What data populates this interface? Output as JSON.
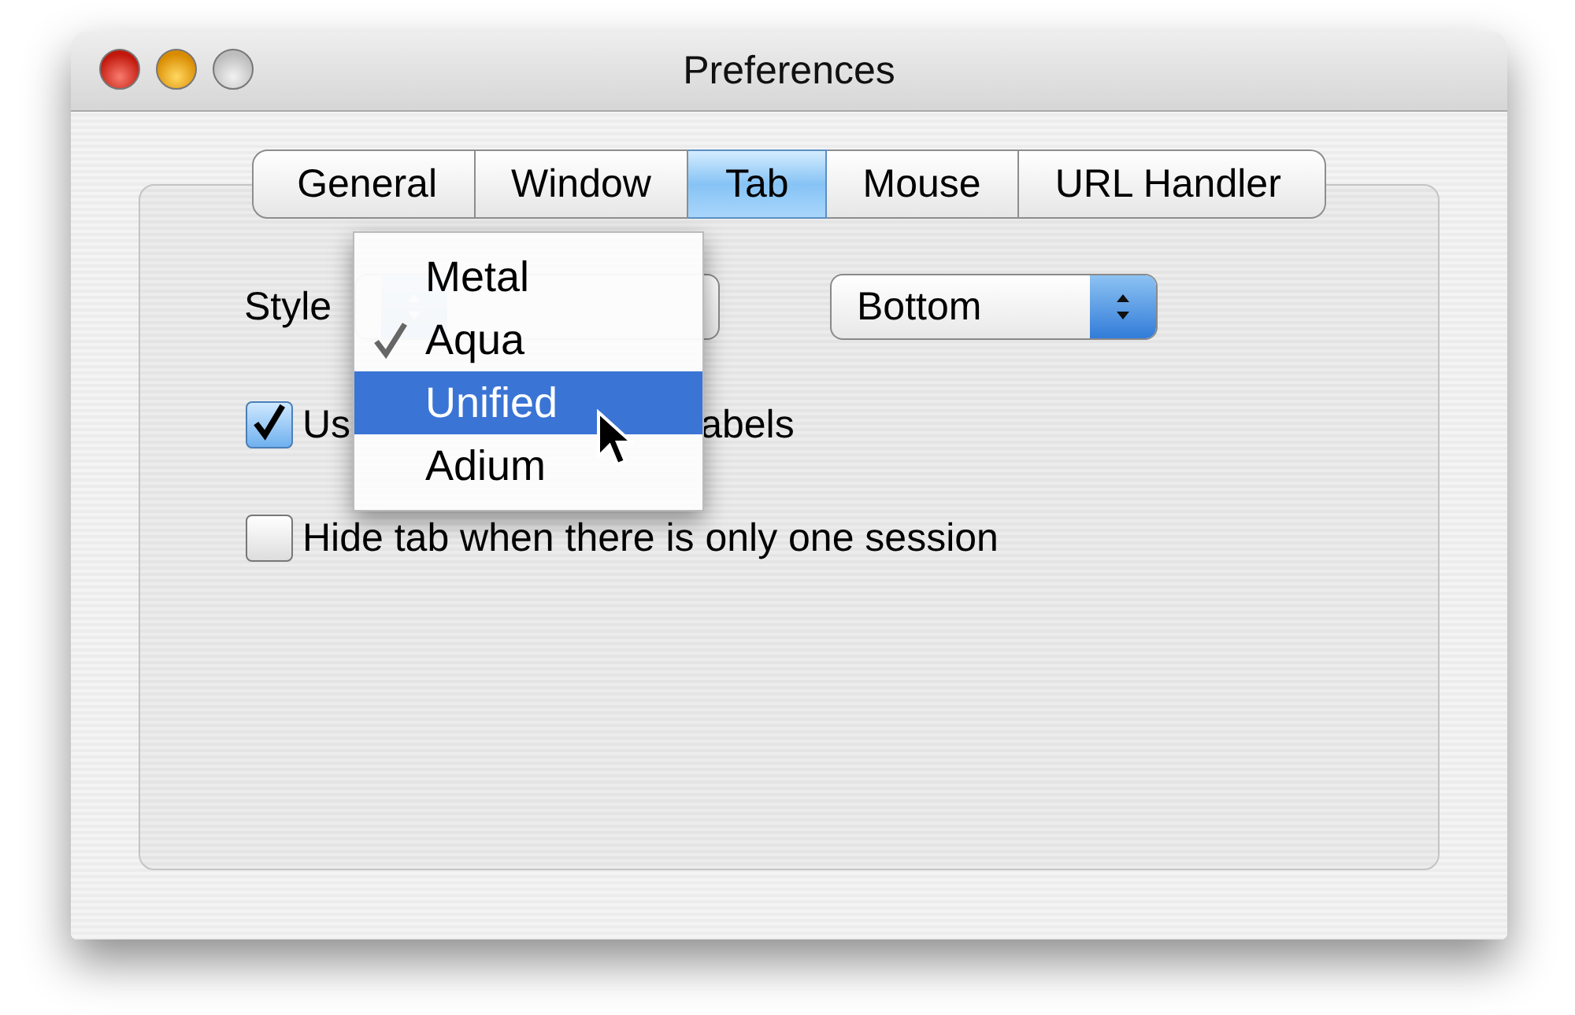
{
  "window": {
    "title": "Preferences",
    "zoom_disabled": true
  },
  "tabs": [
    {
      "label": "General",
      "selected": false
    },
    {
      "label": "Window",
      "selected": false
    },
    {
      "label": "Tab",
      "selected": true
    },
    {
      "label": "Mouse",
      "selected": false
    },
    {
      "label": "URL Handler",
      "selected": false
    }
  ],
  "style_row": {
    "label": "Style"
  },
  "position_popup": {
    "value": "Bottom"
  },
  "checkboxes": [
    {
      "label_parts": [
        "Us",
        "abels"
      ],
      "checked": true
    },
    {
      "label_parts": [
        "Hide tab when there is only one session"
      ],
      "checked": false
    }
  ],
  "style_menu": {
    "items": [
      {
        "label": "Metal",
        "checked": false,
        "selected": false
      },
      {
        "label": "Aqua",
        "checked": true,
        "selected": false
      },
      {
        "label": "Unified",
        "checked": false,
        "selected": true
      },
      {
        "label": "Adium",
        "checked": false,
        "selected": false
      }
    ]
  }
}
